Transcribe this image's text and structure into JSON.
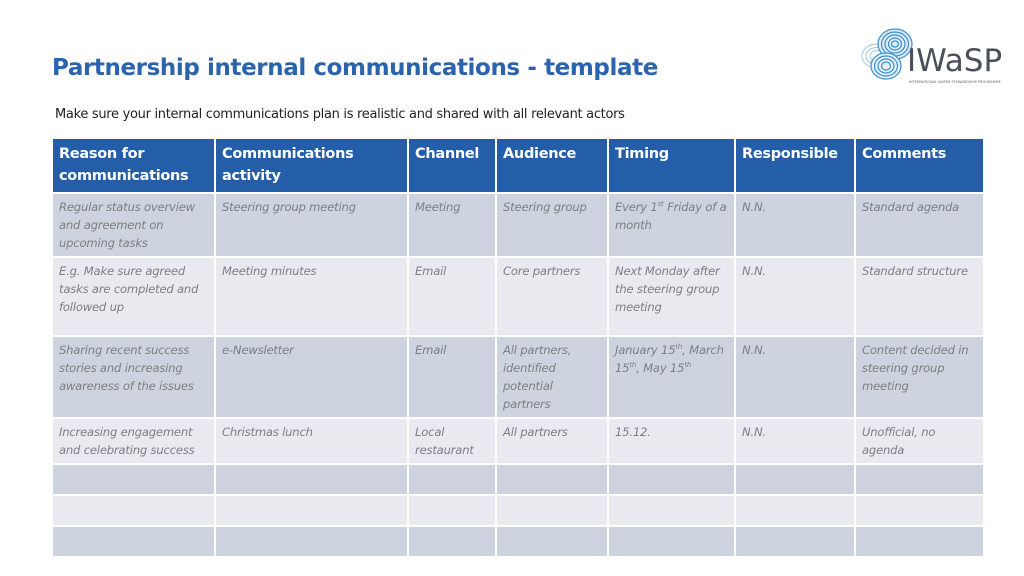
{
  "header": {
    "title": "Partnership internal communications - template",
    "subtitle": "Make sure your internal communications plan is realistic and shared with all relevant actors"
  },
  "logo": {
    "icon": "water-ripple-circles-icon",
    "text": "IWaSP",
    "tagline": "INTERNATIONAL WATER STEWARDSHIP PROGRAMME",
    "colors": {
      "ripple": "#3e8fc9",
      "ripple_light": "#9cc8e6",
      "text": "#4a4f5c"
    }
  },
  "colors": {
    "title": "#2b63ad",
    "header_bg": "#255ea8",
    "row_dark": "#cdd3df",
    "row_light": "#e8eaef",
    "cell_text": "#7d7f84"
  },
  "table": {
    "columns": [
      "Reason for communications",
      "Communications activity",
      "Channel",
      "Audience",
      "Timing",
      "Responsible",
      "Comments"
    ],
    "rows": [
      {
        "reason": "Regular status overview and agreement on upcoming tasks",
        "activity": "Steering group meeting",
        "channel": "Meeting",
        "audience": "Steering group",
        "timing_parts": [
          "Every 1",
          "st",
          " Friday of a month"
        ],
        "responsible": "N.N.",
        "comments": "Standard agenda"
      },
      {
        "reason": "E.g. Make sure agreed tasks are completed and followed up",
        "activity": "Meeting minutes",
        "channel": "Email",
        "audience": "Core partners",
        "timing_parts": [
          "Next Monday after the steering group meeting"
        ],
        "responsible": "N.N.",
        "comments": "Standard structure"
      },
      {
        "reason": "Sharing recent success stories and increasing awareness of the issues",
        "activity": "e-Newsletter",
        "channel": "Email",
        "audience": "All partners, identified potential partners",
        "timing_parts": [
          "January 15",
          "th",
          ", March 15",
          "th",
          ", May 15",
          "th"
        ],
        "responsible": "N.N.",
        "comments": "Content decided in steering group meeting"
      },
      {
        "reason": "Increasing engagement and celebrating success",
        "activity": "Christmas lunch",
        "channel": "Local restaurant",
        "audience": "All partners",
        "timing_parts": [
          "15.12."
        ],
        "responsible": "N.N.",
        "comments": "Unofficial, no agenda"
      },
      {
        "reason": "",
        "activity": "",
        "channel": "",
        "audience": "",
        "timing_parts": [
          ""
        ],
        "responsible": "",
        "comments": ""
      },
      {
        "reason": "",
        "activity": "",
        "channel": "",
        "audience": "",
        "timing_parts": [
          ""
        ],
        "responsible": "",
        "comments": ""
      },
      {
        "reason": "",
        "activity": "",
        "channel": "",
        "audience": "",
        "timing_parts": [
          ""
        ],
        "responsible": "",
        "comments": ""
      }
    ]
  }
}
